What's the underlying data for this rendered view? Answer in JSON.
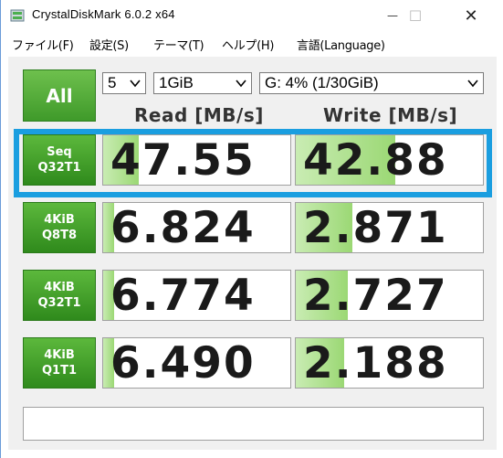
{
  "window": {
    "title": "CrystalDiskMark 6.0.2 x64",
    "minimize_glyph": "—",
    "maximize_glyph": "☐",
    "close_glyph": "✕"
  },
  "menu": {
    "items": [
      {
        "label": "ファイル(F)"
      },
      {
        "label": "設定(S)"
      },
      {
        "label": "テーマ(T)"
      },
      {
        "label": "ヘルプ(H)"
      },
      {
        "label": "言語(Language)"
      }
    ]
  },
  "controls": {
    "all_label": "All",
    "count_value": "5",
    "size_value": "1GiB",
    "drive_value": "G: 4% (1/30GiB)"
  },
  "columns": {
    "read": "Read [MB/s]",
    "write": "Write [MB/s]"
  },
  "rows": [
    {
      "line1": "Seq",
      "line2": "Q32T1",
      "read": "47.55",
      "write": "42.88",
      "read_fill": 0.19,
      "write_fill": 0.53
    },
    {
      "line1": "4KiB",
      "line2": "Q8T8",
      "read": "6.824",
      "write": "2.871",
      "read_fill": 0.06,
      "write_fill": 0.3
    },
    {
      "line1": "4KiB",
      "line2": "Q32T1",
      "read": "6.774",
      "write": "2.727",
      "read_fill": 0.06,
      "write_fill": 0.28
    },
    {
      "line1": "4KiB",
      "line2": "Q1T1",
      "read": "6.490",
      "write": "2.188",
      "read_fill": 0.06,
      "write_fill": 0.26
    }
  ],
  "comment": "",
  "colors": {
    "accent_green": "#3f9a2a",
    "highlight_blue": "#1a9ee0"
  }
}
